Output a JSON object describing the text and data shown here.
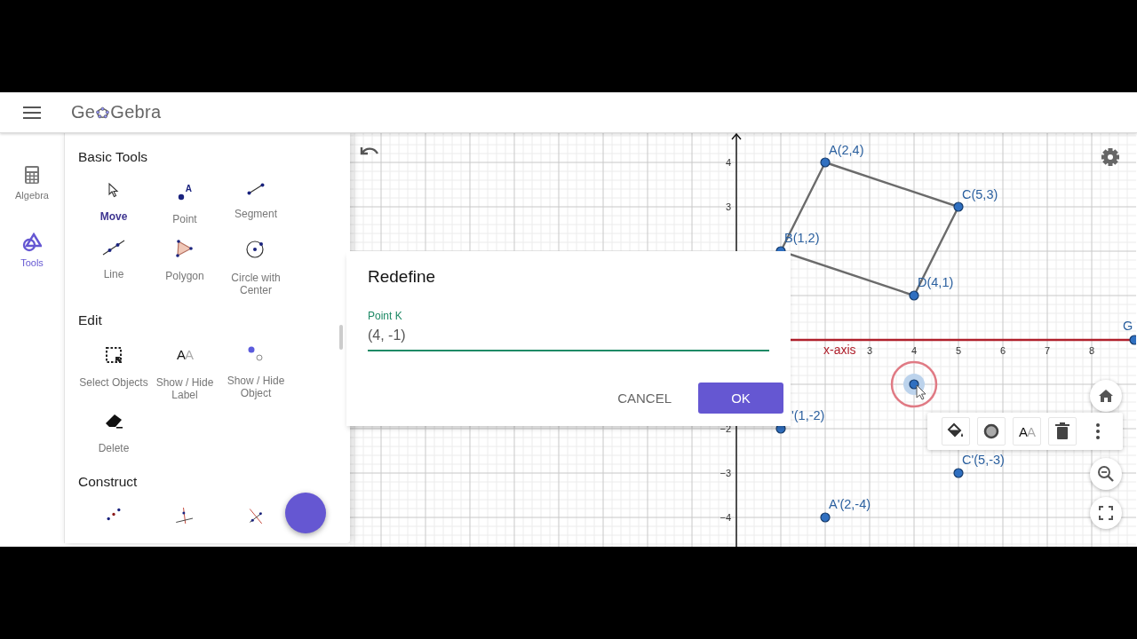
{
  "header": {
    "logo": [
      "Ge",
      "Gebra"
    ]
  },
  "rail": [
    {
      "label": "Algebra",
      "kind": "algebra",
      "selected": false
    },
    {
      "label": "Tools",
      "kind": "tools",
      "selected": true
    }
  ],
  "tool_sections": [
    {
      "title": "Basic Tools",
      "tools": [
        {
          "label": "Move",
          "kind": "move",
          "selected": true
        },
        {
          "label": "Point",
          "kind": "point",
          "icon_text": "A",
          "selected": false
        },
        {
          "label": "Segment",
          "kind": "segment",
          "selected": false
        },
        {
          "label": "Line",
          "kind": "line",
          "selected": false
        },
        {
          "label": "Polygon",
          "kind": "polygon",
          "selected": false
        },
        {
          "label": "Circle with Center",
          "kind": "circle",
          "selected": false
        }
      ]
    },
    {
      "title": "Edit",
      "tools": [
        {
          "label": "Select Objects",
          "kind": "select",
          "selected": false
        },
        {
          "label": "Show / Hide Label",
          "kind": "show-label",
          "icon_text": [
            "A",
            "A"
          ],
          "selected": false
        },
        {
          "label": "Show / Hide Object",
          "kind": "show-object",
          "selected": false
        },
        {
          "label": "Delete",
          "kind": "delete",
          "selected": false
        }
      ]
    },
    {
      "title": "Construct",
      "tools": [
        {
          "kind": "midpoint"
        },
        {
          "kind": "perpendicular"
        },
        {
          "kind": "parallel"
        }
      ]
    }
  ],
  "graph": {
    "y_tick_labels": [
      "4",
      "3",
      "−2",
      "−3",
      "−4"
    ],
    "x_tick_labels": [
      "3",
      "4",
      "5",
      "6",
      "7",
      "8"
    ],
    "axis_label": "x-axis",
    "points": [
      {
        "label": "A(2,4)",
        "selected": false
      },
      {
        "label": "C(5,3)",
        "selected": false
      },
      {
        "label": "B(1,2)",
        "selected": false
      },
      {
        "label": "D(4,1)",
        "selected": false
      },
      {
        "label": "G",
        "selected": false
      },
      {
        "label": "'(1,-2)",
        "selected": false
      },
      {
        "label": "C'(5,-3)",
        "selected": false
      },
      {
        "label": "A'(2,-4)",
        "selected": false
      },
      {
        "selected": true
      }
    ]
  },
  "style_bar": {
    "buttons": [
      {
        "kind": "color"
      },
      {
        "kind": "point-style"
      },
      {
        "kind": "label",
        "icon_text": [
          "A",
          "A"
        ]
      },
      {
        "kind": "delete"
      },
      {
        "kind": "more"
      }
    ]
  },
  "dialog": {
    "title": "Redefine",
    "field_label": "Point K",
    "value": "(4, -1)",
    "buttons": [
      {
        "label": "CANCEL",
        "kind": "text"
      },
      {
        "label": "OK",
        "kind": "primary"
      }
    ]
  }
}
